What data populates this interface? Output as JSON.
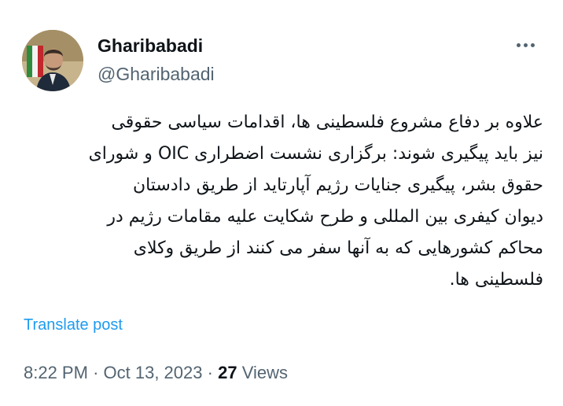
{
  "author": {
    "display_name": "Gharibabadi",
    "handle": "@Gharibabadi"
  },
  "more_icon": "more-horizontal-icon",
  "post": {
    "lines": [
      "علاوه بر دفاع مشروع فلسطینی ها، اقدامات سیاسی حقوقی",
      "نیز باید پیگیری شوند: برگزاری نشست اضطراری OIC و شورای",
      "حقوق بشر، پیگیری جنایات رژیم آپارتاید از طریق دادستان",
      "دیوان کیفری بین المللی و طرح شکایت علیه مقامات رژیم در",
      "محاکم کشورهایی که به آنها سفر می کنند از طریق وکلای",
      "فلسطینی ها."
    ]
  },
  "translate_label": "Translate post",
  "meta": {
    "time": "8:22 PM",
    "separator": "·",
    "date": "Oct 13, 2023",
    "views_count": "27",
    "views_label": "Views"
  },
  "colors": {
    "link": "#1d9bf0",
    "secondary_text": "#536471",
    "primary_text": "#0f1419"
  }
}
